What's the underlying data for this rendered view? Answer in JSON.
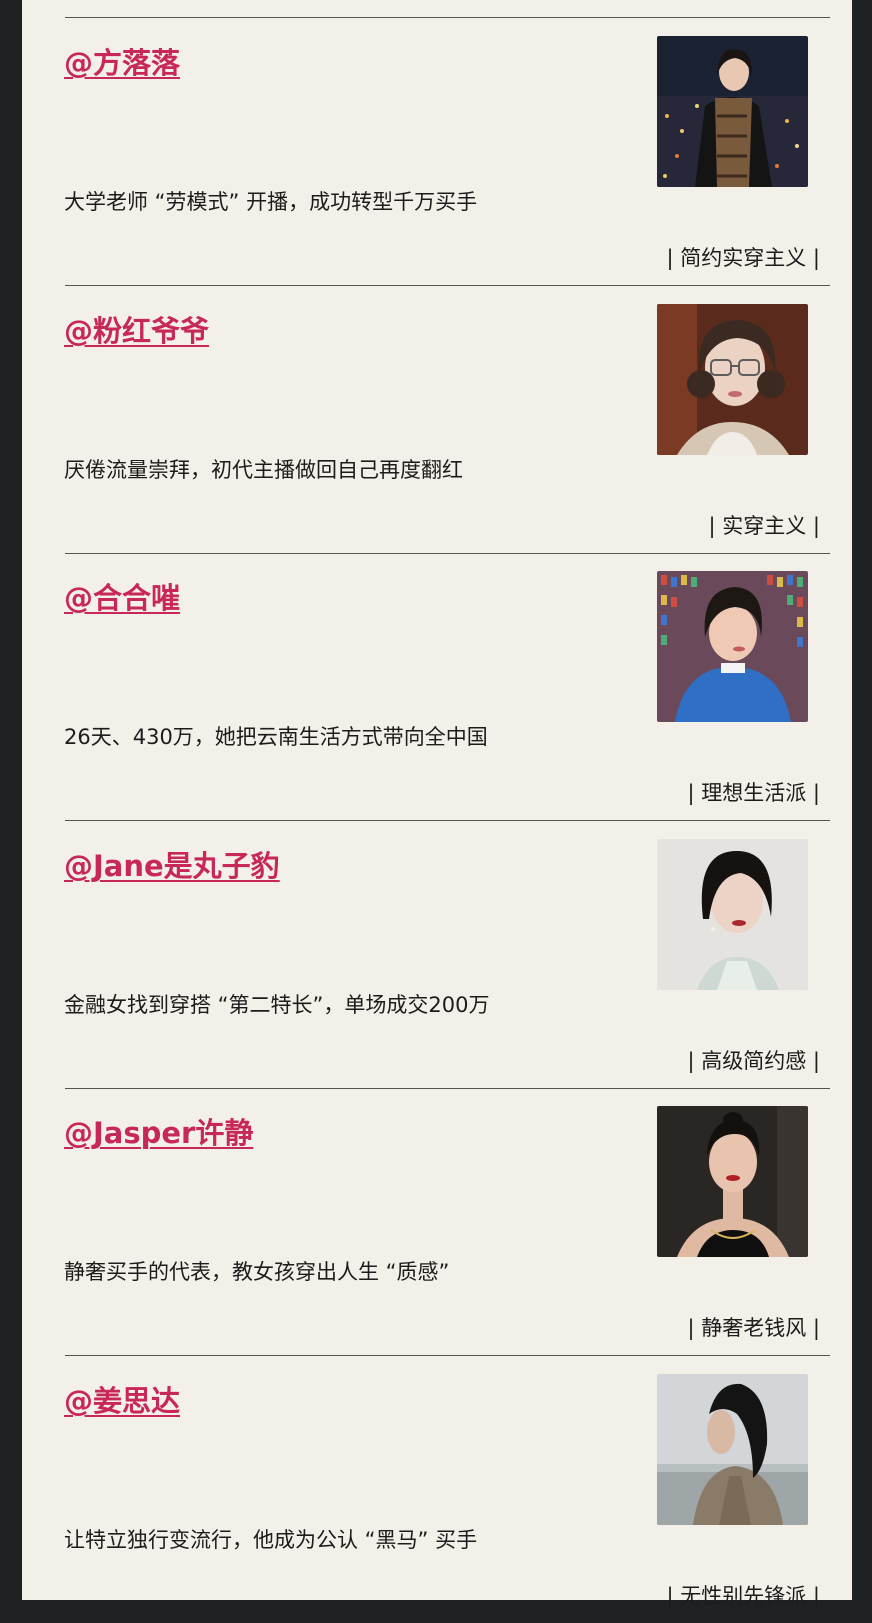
{
  "entries": [
    {
      "handle": "@方落落",
      "description": "大学老师 “劳模式” 开播，成功转型千万买手",
      "tag": "| 简约实穿主义 |",
      "photo_icon": "woman-scarf-city-night-photo"
    },
    {
      "handle": "@粉红爷爷",
      "description": "厌倦流量崇拜，初代主播做回自己再度翻红",
      "tag": "| 实穿主义 |",
      "photo_icon": "woman-glasses-portrait-photo"
    },
    {
      "handle": "@合合嗺",
      "description": "26天、430万，她把云南生活方式带向全中国",
      "tag": "| 理想生活派 |",
      "photo_icon": "woman-blue-sweater-photo"
    },
    {
      "handle": "@Jane是丸子豹",
      "description": "金融女找到穿搭 “第二特长”，单场成交200万",
      "tag": "| 高级简约感 |",
      "photo_icon": "woman-short-hair-portrait-photo"
    },
    {
      "handle": "@Jasper许静",
      "description": "静奢买手的代表，教女孩穿出人生 “质感”",
      "tag": "| 静奢老钱风 |",
      "photo_icon": "woman-black-dress-photo"
    },
    {
      "handle": "@姜思达",
      "description": "让特立独行变流行，他成为公认 “黑马” 买手",
      "tag": "| 无性别先锋派 |",
      "photo_icon": "person-seaside-coat-photo"
    }
  ],
  "colors": {
    "handle": "#c8275a",
    "background": "#f2f0e8",
    "frame": "#1f2223",
    "text": "#1c1c1c"
  }
}
